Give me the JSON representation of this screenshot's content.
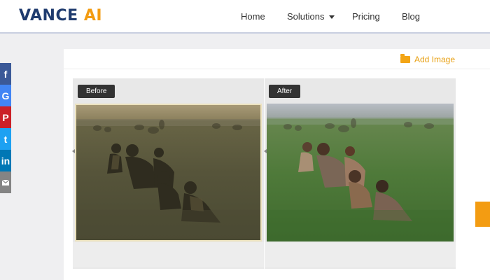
{
  "logo": {
    "part1": "VANCE ",
    "part2": "AI"
  },
  "nav": {
    "home": "Home",
    "solutions": "Solutions",
    "pricing": "Pricing",
    "blog": "Blog"
  },
  "social": {
    "facebook": "f",
    "google": "G",
    "pinterest": "P",
    "twitter": "t",
    "linkedin": "in"
  },
  "toolbar": {
    "add_image": "Add Image"
  },
  "compare": {
    "before_label": "Before",
    "after_label": "After"
  },
  "colors": {
    "brand_blue": "#1f3b6e",
    "brand_orange": "#f39c12"
  }
}
